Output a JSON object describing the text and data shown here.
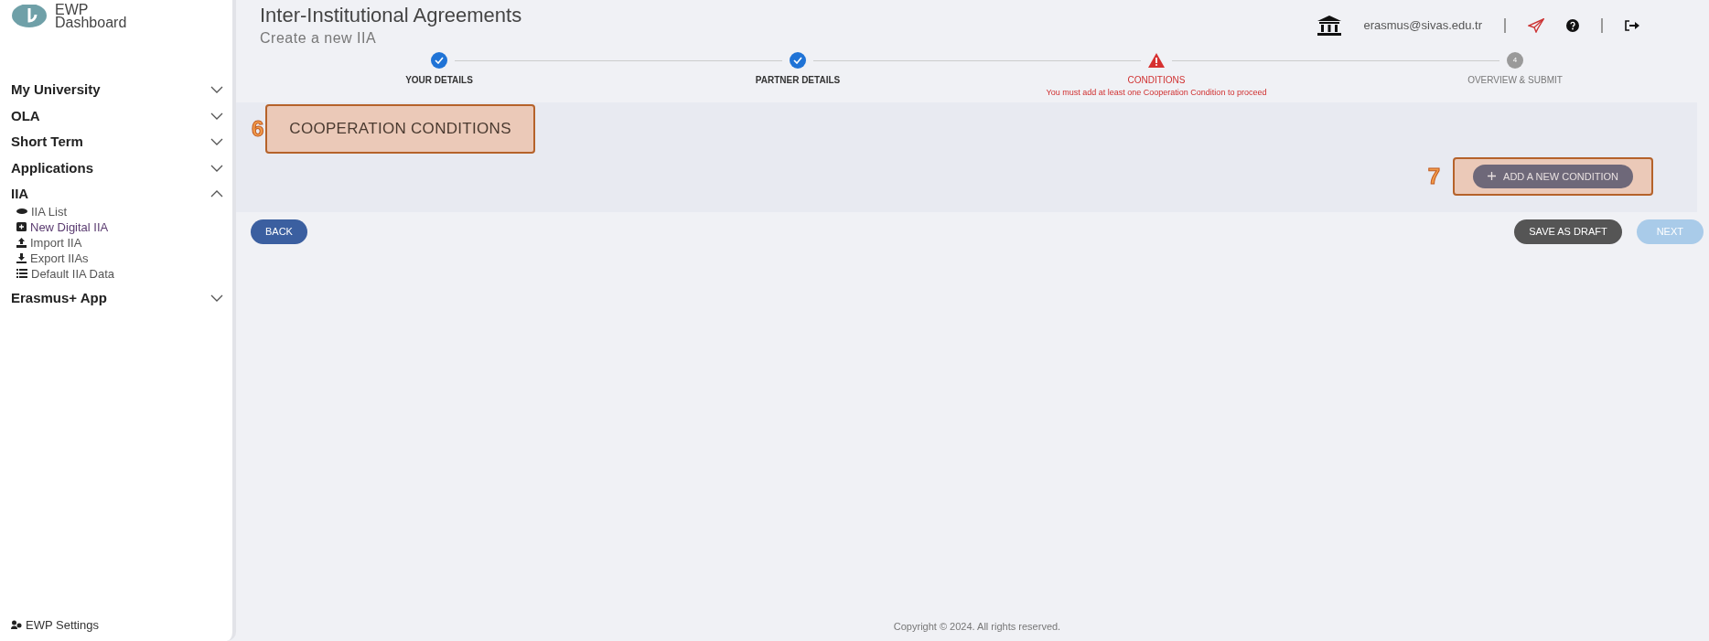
{
  "sidebar": {
    "logo": {
      "line1": "EWP",
      "line2": "Dashboard"
    },
    "items": [
      {
        "label": "My University",
        "expanded": false
      },
      {
        "label": "OLA",
        "expanded": false
      },
      {
        "label": "Short Term",
        "expanded": false
      },
      {
        "label": "Applications",
        "expanded": false
      },
      {
        "label": "IIA",
        "expanded": true,
        "children": [
          {
            "label": "IIA List",
            "kind": "list"
          },
          {
            "label": "New Digital IIA",
            "kind": "new"
          },
          {
            "label": "Import IIA",
            "kind": "import"
          },
          {
            "label": "Export IIAs",
            "kind": "export"
          },
          {
            "label": "Default IIA Data",
            "kind": "data"
          }
        ]
      },
      {
        "label": "Erasmus+ App",
        "expanded": false
      }
    ],
    "settings": "EWP Settings"
  },
  "header": {
    "title": "Inter-Institutional Agreements",
    "subtitle": "Create a new IIA",
    "user": "erasmus@sivas.edu.tr"
  },
  "steps": [
    {
      "label": "YOUR DETAILS",
      "kind": "done"
    },
    {
      "label": "PARTNER DETAILS",
      "kind": "done"
    },
    {
      "label": "CONDITIONS",
      "kind": "error",
      "message": "You must add at least one Cooperation Condition to proceed"
    },
    {
      "label": "OVERVIEW & SUBMIT",
      "kind": "pending",
      "number": "4"
    }
  ],
  "panel": {
    "heading": "COOPERATION CONDITIONS",
    "heading_callout": "6",
    "add_button": "ADD A NEW CONDITION",
    "add_callout": "7"
  },
  "actions": {
    "back": "BACK",
    "save": "SAVE AS DRAFT",
    "next": "NEXT",
    "next_disabled": true
  },
  "footer": "Copyright © 2024. All rights reserved."
}
